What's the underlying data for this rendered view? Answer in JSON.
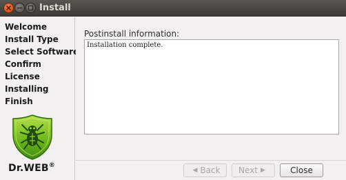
{
  "window": {
    "title": "Install"
  },
  "sidebar": {
    "steps": [
      "Welcome",
      "Install Type",
      "Select Software",
      "Confirm",
      "License",
      "Installing",
      "Finish"
    ]
  },
  "logo": {
    "text": "Dr.WEB",
    "mark": "®"
  },
  "content": {
    "label": "Postinstall information:",
    "text": "Installation complete."
  },
  "buttons": {
    "back": "Back",
    "next": "Next",
    "close": "Close"
  },
  "colors": {
    "accent": "#e05a22",
    "logo_green": "#7fc41c",
    "titlebar": "#3c3b37"
  }
}
